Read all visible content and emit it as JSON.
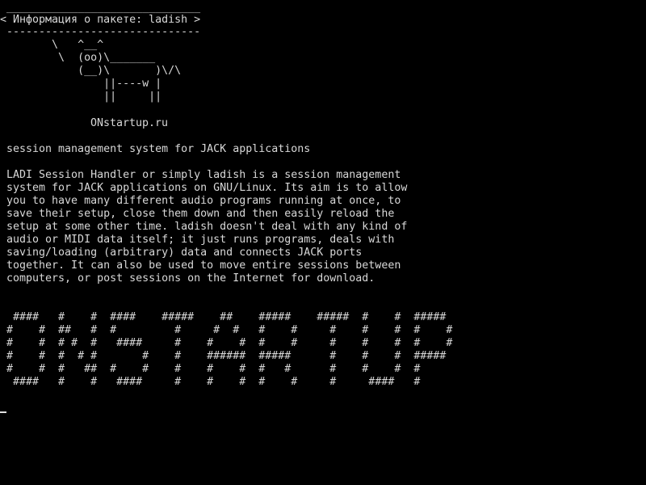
{
  "screen": {
    "background": "#000000",
    "foreground": "#d8d8d8"
  },
  "cowsay": {
    "top_border": " ______________________________",
    "bubble_text": "< Информация о пакете: ladish >",
    "bottom_border": " ------------------------------",
    "cow": [
      "        \\   ^__^",
      "         \\  (oo)\\_______",
      "            (__)\\       )\\/\\",
      "                ||----w |",
      "                ||     ||"
    ]
  },
  "site_name": "ONstartup.ru",
  "package": {
    "summary": "session management system for JACK applications",
    "description": [
      "LADI Session Handler or simply ladish is a session management",
      "system for JACK applications on GNU/Linux. Its aim is to allow",
      "you to have many different audio programs running at once, to",
      "save their setup, close them down and then easily reload the",
      "setup at some other time. ladish doesn't deal with any kind of",
      "audio or MIDI data itself; it just runs programs, deals with",
      "saving/loading (arbitrary) data and connects JACK ports",
      "together. It can also be used to move entire sessions between",
      "computers, or post sessions on the Internet for download."
    ]
  },
  "banner": [
    "  ####   #    #  ####    #####    ##    #####    #####  #    #  #####",
    " #    #  ##   #  #         #     #  #   #    #     #    #    #  #    #",
    " #    #  # #  #   ####     #    #    #  #    #     #    #    #  #    #",
    " #    #  #  # #       #    #    ######  #####      #    #    #  #####",
    " #    #  #   ##  #    #    #    #    #  #   #      #    #    #  #",
    "  ####   #    #   ####     #    #    #  #    #     #     ####   #"
  ]
}
